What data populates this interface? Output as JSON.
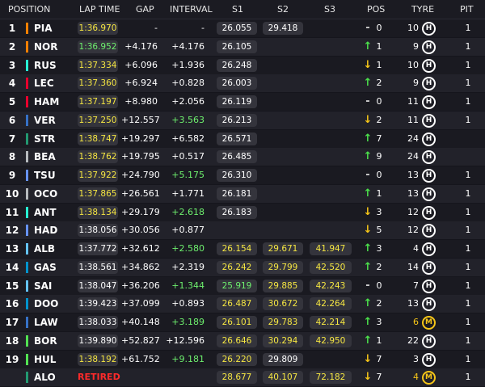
{
  "header": {
    "position": "POSITION",
    "lap_time": "LAP TIME",
    "gap": "GAP",
    "interval": "INTERVAL",
    "s1": "S1",
    "s2": "S2",
    "s3": "S3",
    "pos": "POS",
    "tyre": "TYRE",
    "pit": "PIT"
  },
  "colors": {
    "personal_best": "#f5e642",
    "fastest": "#6ef06e",
    "retired": "#ff2a2a",
    "gain": "#4be04b",
    "loss": "#f5c518"
  },
  "rows": [
    {
      "pos": "1",
      "driver": "PIA",
      "team_color": "#ff8000",
      "lap": "1:36.970",
      "lap_c": "yellow",
      "gap": "-",
      "int": "-",
      "int_c": "white",
      "s1": "26.055",
      "s1_c": "white",
      "s2": "29.418",
      "s2_c": "white",
      "s3": "",
      "s3_c": "white",
      "arrow": "-",
      "arrow_dir": "flat",
      "poschange": "0",
      "laps": "10",
      "tyre": "H",
      "tyre_type": "hard",
      "pit": "1"
    },
    {
      "pos": "2",
      "driver": "NOR",
      "team_color": "#ff8000",
      "lap": "1:36.952",
      "lap_c": "green",
      "gap": "+4.176",
      "int": "+4.176",
      "int_c": "white",
      "s1": "26.105",
      "s1_c": "white",
      "s2": "",
      "s2_c": "white",
      "s3": "",
      "s3_c": "white",
      "arrow": "↑",
      "arrow_dir": "up",
      "poschange": "1",
      "laps": "9",
      "tyre": "H",
      "tyre_type": "hard",
      "pit": "1"
    },
    {
      "pos": "3",
      "driver": "RUS",
      "team_color": "#27f4d2",
      "lap": "1:37.334",
      "lap_c": "yellow",
      "gap": "+6.096",
      "int": "+1.936",
      "int_c": "white",
      "s1": "26.248",
      "s1_c": "white",
      "s2": "",
      "s2_c": "white",
      "s3": "",
      "s3_c": "white",
      "arrow": "↓",
      "arrow_dir": "down",
      "poschange": "1",
      "laps": "10",
      "tyre": "H",
      "tyre_type": "hard",
      "pit": "1"
    },
    {
      "pos": "4",
      "driver": "LEC",
      "team_color": "#e8002d",
      "lap": "1:37.360",
      "lap_c": "yellow",
      "gap": "+6.924",
      "int": "+0.828",
      "int_c": "white",
      "s1": "26.003",
      "s1_c": "white",
      "s2": "",
      "s2_c": "white",
      "s3": "",
      "s3_c": "white",
      "arrow": "↑",
      "arrow_dir": "up",
      "poschange": "2",
      "laps": "9",
      "tyre": "H",
      "tyre_type": "hard",
      "pit": "1"
    },
    {
      "pos": "5",
      "driver": "HAM",
      "team_color": "#e8002d",
      "lap": "1:37.197",
      "lap_c": "yellow",
      "gap": "+8.980",
      "int": "+2.056",
      "int_c": "white",
      "s1": "26.119",
      "s1_c": "white",
      "s2": "",
      "s2_c": "white",
      "s3": "",
      "s3_c": "white",
      "arrow": "-",
      "arrow_dir": "flat",
      "poschange": "0",
      "laps": "11",
      "tyre": "H",
      "tyre_type": "hard",
      "pit": "1"
    },
    {
      "pos": "6",
      "driver": "VER",
      "team_color": "#3671c6",
      "lap": "1:37.250",
      "lap_c": "yellow",
      "gap": "+12.557",
      "int": "+3.563",
      "int_c": "green",
      "s1": "26.213",
      "s1_c": "white",
      "s2": "",
      "s2_c": "white",
      "s3": "",
      "s3_c": "white",
      "arrow": "↓",
      "arrow_dir": "down",
      "poschange": "2",
      "laps": "11",
      "tyre": "H",
      "tyre_type": "hard",
      "pit": "1"
    },
    {
      "pos": "7",
      "driver": "STR",
      "team_color": "#229971",
      "lap": "1:38.747",
      "lap_c": "yellow",
      "gap": "+19.297",
      "int": "+6.582",
      "int_c": "white",
      "s1": "26.571",
      "s1_c": "white",
      "s2": "",
      "s2_c": "white",
      "s3": "",
      "s3_c": "white",
      "arrow": "↑",
      "arrow_dir": "up",
      "poschange": "7",
      "laps": "24",
      "tyre": "H",
      "tyre_type": "hard",
      "pit": ""
    },
    {
      "pos": "8",
      "driver": "BEA",
      "team_color": "#b6babd",
      "lap": "1:38.762",
      "lap_c": "yellow",
      "gap": "+19.795",
      "int": "+0.517",
      "int_c": "white",
      "s1": "26.485",
      "s1_c": "white",
      "s2": "",
      "s2_c": "white",
      "s3": "",
      "s3_c": "white",
      "arrow": "↑",
      "arrow_dir": "up",
      "poschange": "9",
      "laps": "24",
      "tyre": "H",
      "tyre_type": "hard",
      "pit": ""
    },
    {
      "pos": "9",
      "driver": "TSU",
      "team_color": "#6692ff",
      "lap": "1:37.922",
      "lap_c": "yellow",
      "gap": "+24.790",
      "int": "+5.175",
      "int_c": "green",
      "s1": "26.310",
      "s1_c": "white",
      "s2": "",
      "s2_c": "white",
      "s3": "",
      "s3_c": "white",
      "arrow": "-",
      "arrow_dir": "flat",
      "poschange": "0",
      "laps": "13",
      "tyre": "H",
      "tyre_type": "hard",
      "pit": "1"
    },
    {
      "pos": "10",
      "driver": "OCO",
      "team_color": "#b6babd",
      "lap": "1:37.865",
      "lap_c": "yellow",
      "gap": "+26.561",
      "int": "+1.771",
      "int_c": "white",
      "s1": "26.181",
      "s1_c": "white",
      "s2": "",
      "s2_c": "white",
      "s3": "",
      "s3_c": "white",
      "arrow": "↑",
      "arrow_dir": "up",
      "poschange": "1",
      "laps": "13",
      "tyre": "H",
      "tyre_type": "hard",
      "pit": "1"
    },
    {
      "pos": "11",
      "driver": "ANT",
      "team_color": "#27f4d2",
      "lap": "1:38.134",
      "lap_c": "yellow",
      "gap": "+29.179",
      "int": "+2.618",
      "int_c": "green",
      "s1": "26.183",
      "s1_c": "white",
      "s2": "",
      "s2_c": "white",
      "s3": "",
      "s3_c": "white",
      "arrow": "↓",
      "arrow_dir": "down",
      "poschange": "3",
      "laps": "12",
      "tyre": "H",
      "tyre_type": "hard",
      "pit": "1"
    },
    {
      "pos": "12",
      "driver": "HAD",
      "team_color": "#6692ff",
      "lap": "1:38.056",
      "lap_c": "white",
      "gap": "+30.056",
      "int": "+0.877",
      "int_c": "white",
      "s1": "",
      "s1_c": "white",
      "s2": "",
      "s2_c": "white",
      "s3": "",
      "s3_c": "white",
      "arrow": "↓",
      "arrow_dir": "down",
      "poschange": "5",
      "laps": "12",
      "tyre": "H",
      "tyre_type": "hard",
      "pit": "1"
    },
    {
      "pos": "13",
      "driver": "ALB",
      "team_color": "#64c4ff",
      "lap": "1:37.772",
      "lap_c": "white",
      "gap": "+32.612",
      "int": "+2.580",
      "int_c": "green",
      "s1": "26.154",
      "s1_c": "yellow",
      "s2": "29.671",
      "s2_c": "yellow",
      "s3": "41.947",
      "s3_c": "yellow",
      "arrow": "↑",
      "arrow_dir": "up",
      "poschange": "3",
      "laps": "4",
      "tyre": "H",
      "tyre_type": "hard",
      "pit": "1"
    },
    {
      "pos": "14",
      "driver": "GAS",
      "team_color": "#0093cc",
      "lap": "1:38.561",
      "lap_c": "white",
      "gap": "+34.862",
      "int": "+2.319",
      "int_c": "white",
      "s1": "26.242",
      "s1_c": "yellow",
      "s2": "29.799",
      "s2_c": "yellow",
      "s3": "42.520",
      "s3_c": "yellow",
      "arrow": "↑",
      "arrow_dir": "up",
      "poschange": "2",
      "laps": "14",
      "tyre": "H",
      "tyre_type": "hard",
      "pit": "1"
    },
    {
      "pos": "15",
      "driver": "SAI",
      "team_color": "#64c4ff",
      "lap": "1:38.047",
      "lap_c": "white",
      "gap": "+36.206",
      "int": "+1.344",
      "int_c": "green",
      "s1": "25.919",
      "s1_c": "green",
      "s2": "29.885",
      "s2_c": "yellow",
      "s3": "42.243",
      "s3_c": "yellow",
      "arrow": "-",
      "arrow_dir": "flat",
      "poschange": "0",
      "laps": "7",
      "tyre": "H",
      "tyre_type": "hard",
      "pit": "1"
    },
    {
      "pos": "16",
      "driver": "DOO",
      "team_color": "#0093cc",
      "lap": "1:39.423",
      "lap_c": "white",
      "gap": "+37.099",
      "int": "+0.893",
      "int_c": "white",
      "s1": "26.487",
      "s1_c": "yellow",
      "s2": "30.672",
      "s2_c": "yellow",
      "s3": "42.264",
      "s3_c": "yellow",
      "arrow": "↑",
      "arrow_dir": "up",
      "poschange": "2",
      "laps": "13",
      "tyre": "H",
      "tyre_type": "hard",
      "pit": "1"
    },
    {
      "pos": "17",
      "driver": "LAW",
      "team_color": "#3671c6",
      "lap": "1:38.033",
      "lap_c": "white",
      "gap": "+40.148",
      "int": "+3.189",
      "int_c": "green",
      "s1": "26.101",
      "s1_c": "yellow",
      "s2": "29.783",
      "s2_c": "yellow",
      "s3": "42.214",
      "s3_c": "yellow",
      "arrow": "↑",
      "arrow_dir": "up",
      "poschange": "3",
      "laps": "6",
      "tyre": "M",
      "tyre_type": "medium",
      "pit": "1"
    },
    {
      "pos": "18",
      "driver": "BOR",
      "team_color": "#52e252",
      "lap": "1:39.890",
      "lap_c": "white",
      "gap": "+52.827",
      "int": "+12.596",
      "int_c": "white",
      "s1": "26.646",
      "s1_c": "yellow",
      "s2": "30.294",
      "s2_c": "yellow",
      "s3": "42.950",
      "s3_c": "yellow",
      "arrow": "↑",
      "arrow_dir": "up",
      "poschange": "1",
      "laps": "22",
      "tyre": "H",
      "tyre_type": "hard",
      "pit": "1"
    },
    {
      "pos": "19",
      "driver": "HUL",
      "team_color": "#52e252",
      "lap": "1:38.192",
      "lap_c": "yellow",
      "gap": "+61.752",
      "int": "+9.181",
      "int_c": "green",
      "s1": "26.220",
      "s1_c": "yellow",
      "s2": "29.809",
      "s2_c": "white",
      "s3": "",
      "s3_c": "white",
      "arrow": "↓",
      "arrow_dir": "down",
      "poschange": "7",
      "laps": "3",
      "tyre": "H",
      "tyre_type": "hard",
      "pit": "1"
    },
    {
      "pos": "",
      "driver": "ALO",
      "team_color": "#229971",
      "lap": "RETIRED",
      "lap_c": "retired",
      "gap": "",
      "int": "",
      "int_c": "white",
      "s1": "28.677",
      "s1_c": "yellow",
      "s2": "40.107",
      "s2_c": "yellow",
      "s3": "72.182",
      "s3_c": "yellow",
      "arrow": "↓",
      "arrow_dir": "down",
      "poschange": "7",
      "laps": "4",
      "tyre": "M",
      "tyre_type": "medium",
      "pit": "1"
    }
  ]
}
